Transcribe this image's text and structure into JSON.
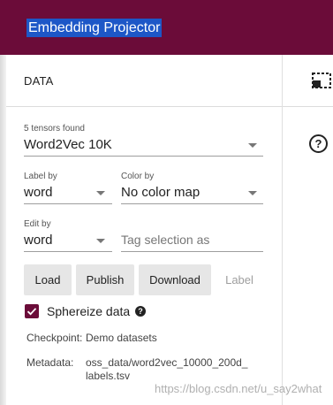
{
  "app": {
    "title": "Embedding Projector"
  },
  "data_panel": {
    "title": "DATA",
    "tensors_found": "5 tensors found",
    "tensor_selected": "Word2Vec 10K",
    "label_by": {
      "label": "Label by",
      "value": "word"
    },
    "color_by": {
      "label": "Color by",
      "value": "No color map"
    },
    "edit_by": {
      "label": "Edit by",
      "value": "word"
    },
    "tag_selection_placeholder": "Tag selection as",
    "buttons": {
      "load": "Load",
      "publish": "Publish",
      "download": "Download",
      "label": "Label"
    },
    "sphereize": {
      "label": "Sphereize data",
      "checked": true
    },
    "checkpoint": {
      "key": "Checkpoint:",
      "value": "Demo datasets"
    },
    "metadata": {
      "key": "Metadata:",
      "value_line1": "oss_data/word2vec_10000_200d_",
      "value_line2": "labels.tsv"
    }
  },
  "watermark": "https://blog.csdn.net/u_say2what",
  "colors": {
    "brand": "#6b0c39",
    "title_highlight": "#1d57c7"
  },
  "icons": [
    "selection-box-icon",
    "help-circle-icon",
    "checkbox-checked-icon"
  ]
}
